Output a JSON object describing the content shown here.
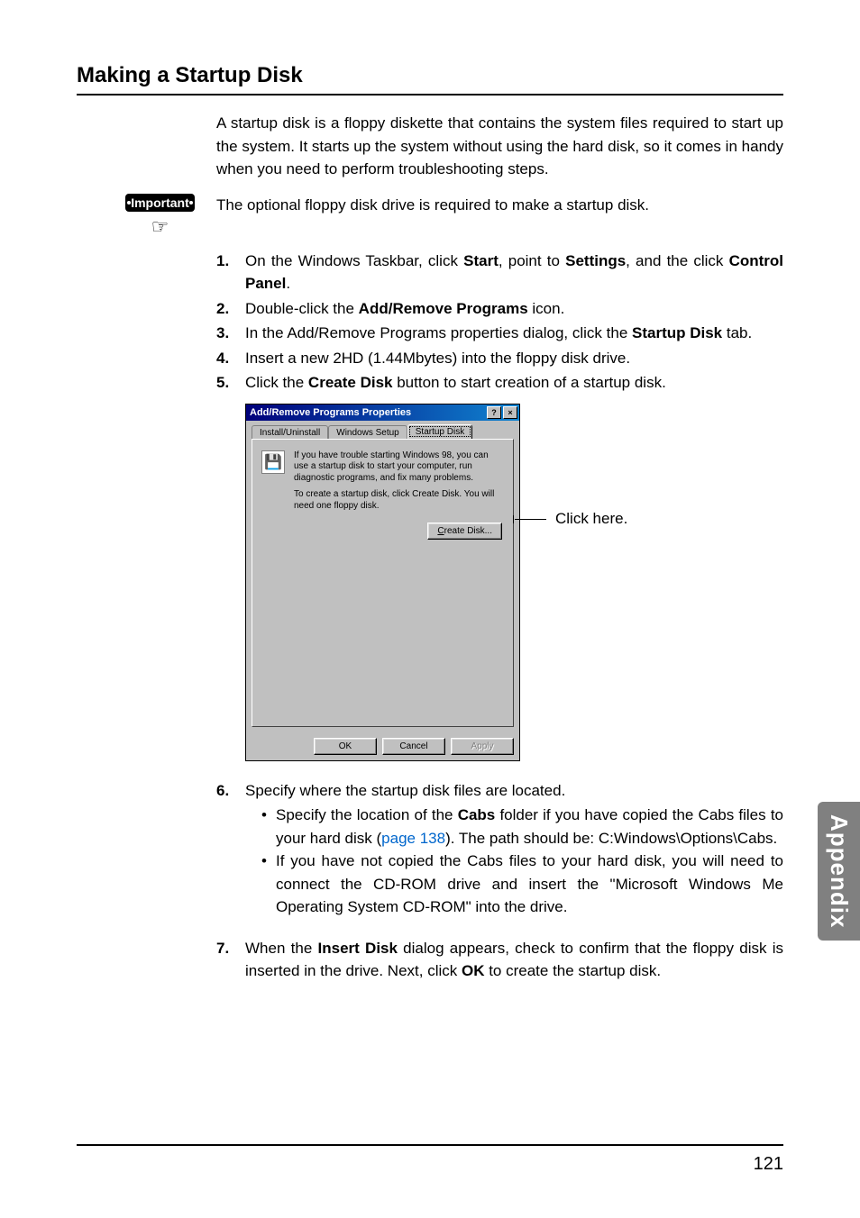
{
  "heading": "Making a Startup Disk",
  "intro": "A startup disk is a floppy diskette that contains the system files required to start up the system. It starts up the system without using the hard disk, so it comes in handy when you need to perform troubleshooting steps.",
  "important_label": "Important",
  "important_text": "The optional floppy disk drive is required to make a startup disk.",
  "steps": {
    "s1_num": "1.",
    "s1_a": "On the Windows Taskbar, click ",
    "s1_b": "Start",
    "s1_c": ", point to ",
    "s1_d": "Settings",
    "s1_e": ", and the click ",
    "s1_f": "Control Panel",
    "s1_g": ".",
    "s2_num": "2.",
    "s2_a": "Double-click the ",
    "s2_b": "Add/Remove Programs",
    "s2_c": " icon.",
    "s3_num": "3.",
    "s3_a": "In the Add/Remove Programs properties dialog, click the ",
    "s3_b": "Startup Disk",
    "s3_c": " tab.",
    "s4_num": "4.",
    "s4": "Insert a new 2HD (1.44Mbytes) into the floppy disk drive.",
    "s5_num": "5.",
    "s5_a": "Click the ",
    "s5_b": "Create Disk",
    "s5_c": " button to start creation of a startup disk.",
    "s6_num": "6.",
    "s6": "Specify where the startup disk files are located.",
    "s6_b1_a": "Specify the location of the ",
    "s6_b1_b": "Cabs",
    "s6_b1_c": " folder if you have copied the Cabs files to your hard disk (",
    "s6_b1_link": "page 138",
    "s6_b1_d": "). The path should be: C:Windows\\Options\\Cabs.",
    "s6_b2": "If you have not copied the Cabs files to your hard disk, you will need to connect the CD-ROM drive and insert the \"Microsoft Windows Me Operating System CD-ROM\" into the drive.",
    "s7_num": "7.",
    "s7_a": "When the ",
    "s7_b": "Insert Disk",
    "s7_c": " dialog appears, check to confirm that the floppy disk is inserted in the drive. Next, click ",
    "s7_d": "OK",
    "s7_e": " to create the startup disk."
  },
  "dialog": {
    "title": "Add/Remove Programs Properties",
    "help_btn": "?",
    "close_btn": "×",
    "tab1": "Install/Uninstall",
    "tab2": "Windows Setup",
    "tab3": "Startup Disk",
    "para1": "If you have trouble starting Windows 98, you can use a startup disk to start your computer, run diagnostic programs, and fix many problems.",
    "para2": "To create a startup disk, click Create Disk. You will need one floppy disk.",
    "create_btn_pre": "C",
    "create_btn_rest": "reate Disk...",
    "ok": "OK",
    "cancel": "Cancel",
    "apply": "Apply"
  },
  "callout": "Click here.",
  "side_tab": "Appendix",
  "page_number": "121"
}
